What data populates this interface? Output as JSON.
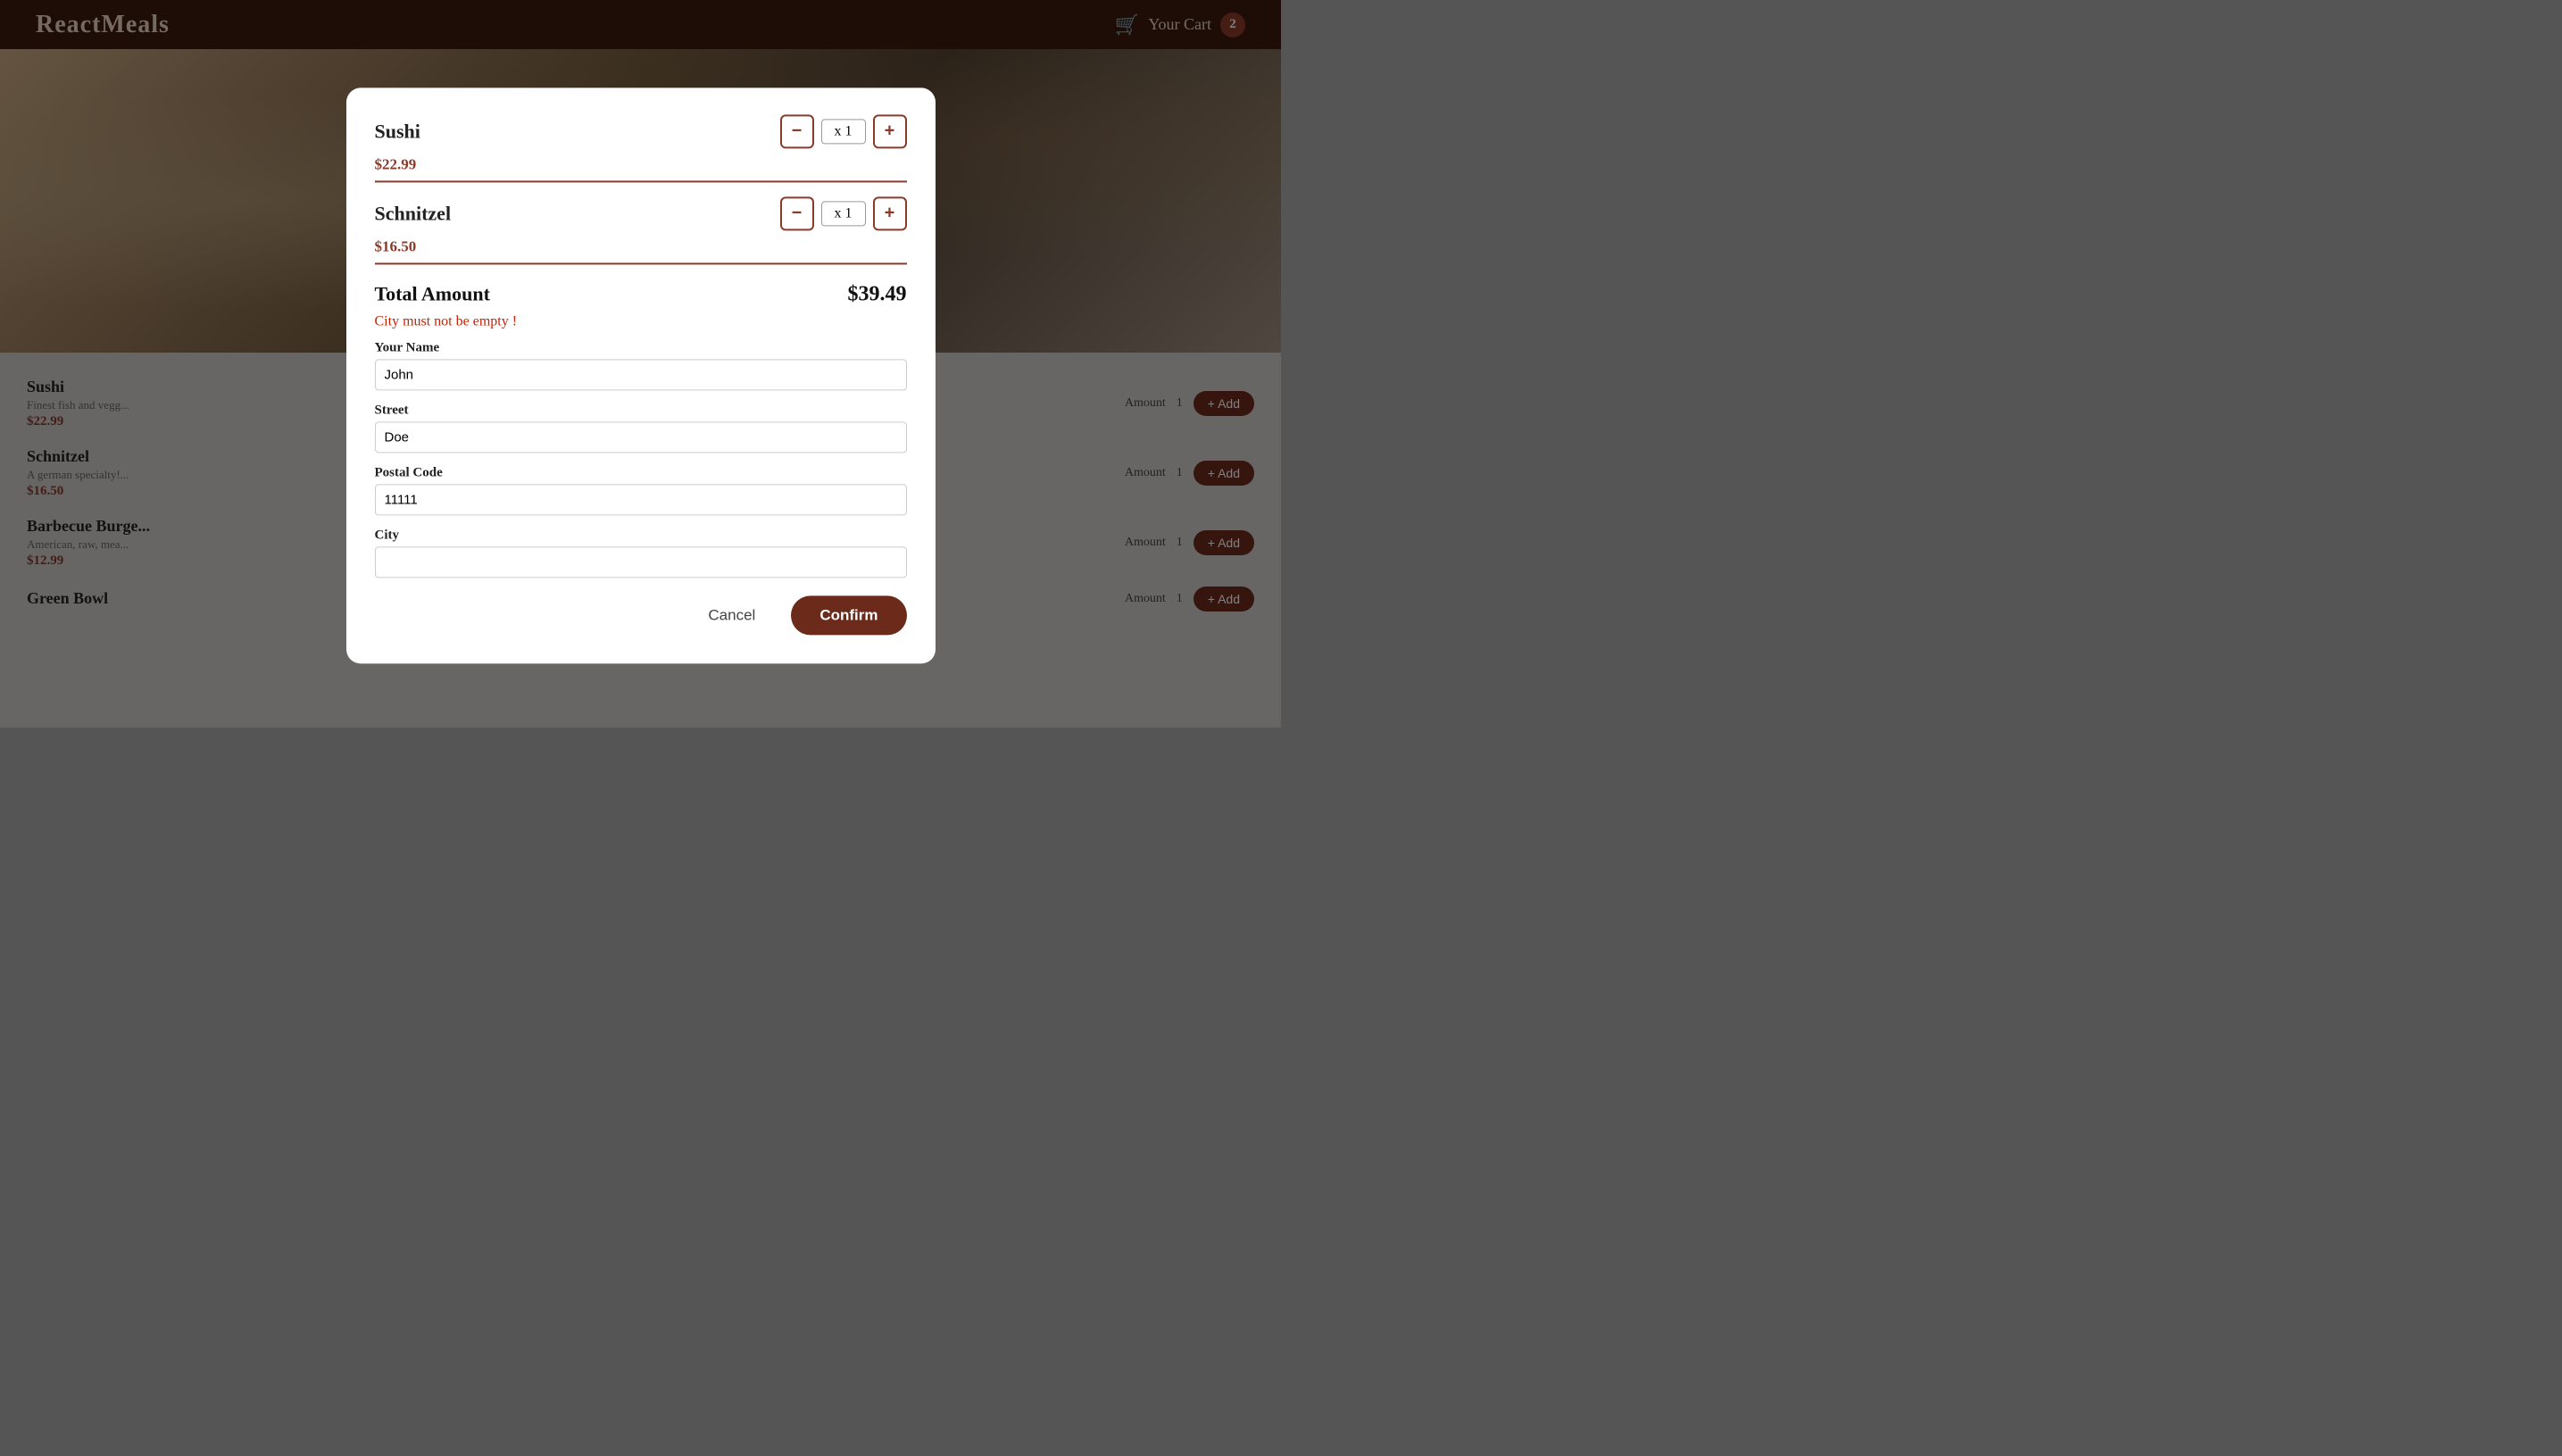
{
  "header": {
    "logo": "ReactMeals",
    "cart_label": "Your Cart",
    "cart_count": "2",
    "cart_icon": "🛒"
  },
  "meal_list": [
    {
      "name": "Sushi",
      "description": "Finest fish and vegg...",
      "price": "$22.99",
      "amount_label": "Amount",
      "qty": "1",
      "add_label": "+ Add"
    },
    {
      "name": "Schnitzel",
      "description": "A german specialty!...",
      "price": "$16.50",
      "amount_label": "Amount",
      "qty": "1",
      "add_label": "+ Add"
    },
    {
      "name": "Barbecue Burge...",
      "description": "American, raw, mea...",
      "price": "$12.99",
      "amount_label": "Amount",
      "qty": "1",
      "add_label": "+ Add"
    },
    {
      "name": "Green Bowl",
      "description": "",
      "price": "",
      "amount_label": "Amount",
      "qty": "1",
      "add_label": "+ Add"
    }
  ],
  "modal": {
    "items": [
      {
        "name": "Sushi",
        "price": "$22.99",
        "qty": "x 1",
        "decrease_label": "−",
        "increase_label": "+"
      },
      {
        "name": "Schnitzel",
        "price": "$16.50",
        "qty": "x 1",
        "decrease_label": "−",
        "increase_label": "+"
      }
    ],
    "total_label": "Total Amount",
    "total_amount": "$39.49",
    "error_message": "City must not be empty !",
    "form": {
      "name_label": "Your Name",
      "name_value": "John",
      "name_placeholder": "Your Name",
      "street_label": "Street",
      "street_value": "Doe",
      "street_placeholder": "Street",
      "postal_label": "Postal Code",
      "postal_value": "11111",
      "postal_placeholder": "Postal Code",
      "city_label": "City",
      "city_value": "",
      "city_placeholder": ""
    },
    "cancel_label": "Cancel",
    "confirm_label": "Confirm"
  }
}
